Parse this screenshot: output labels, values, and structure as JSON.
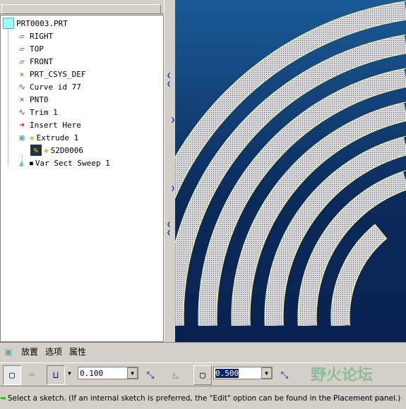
{
  "tree": {
    "items": [
      {
        "label": "PRT0003.PRT",
        "icon": "part-icon"
      },
      {
        "label": "RIGHT",
        "icon": "datum-plane-icon"
      },
      {
        "label": "TOP",
        "icon": "datum-plane-icon"
      },
      {
        "label": "FRONT",
        "icon": "datum-plane-icon"
      },
      {
        "label": "PRT_CSYS_DEF",
        "icon": "csys-icon"
      },
      {
        "label": "Curve id 77",
        "icon": "curve-icon"
      },
      {
        "label": "PNT0",
        "icon": "datum-point-icon"
      },
      {
        "label": "Trim 1",
        "icon": "curve-icon"
      },
      {
        "label": "Insert Here",
        "icon": "insert-arrow-icon"
      },
      {
        "label": "Extrude 1",
        "icon": "extrude-icon",
        "marker": "✱"
      },
      {
        "label": "S2D0006",
        "icon": "sketch-icon",
        "marker": "✱"
      },
      {
        "label": "Var Sect Sweep 1",
        "icon": "sweep-icon",
        "marker": "■"
      }
    ]
  },
  "dashboard": {
    "tabs": [
      "放置",
      "选项",
      "属性"
    ],
    "thickness": "0.100",
    "offset": "0.500",
    "status": "Select a sketch. (If an internal sketch is preferred, the \"Edit\" option can be found in the Placement panel.)"
  },
  "watermark": {
    "text": "野火论坛",
    "url": "www.proewildfire.cn"
  },
  "colors": {
    "graphics_bg": "#0a2a5a",
    "feature_icon": "#9a4a1a"
  }
}
